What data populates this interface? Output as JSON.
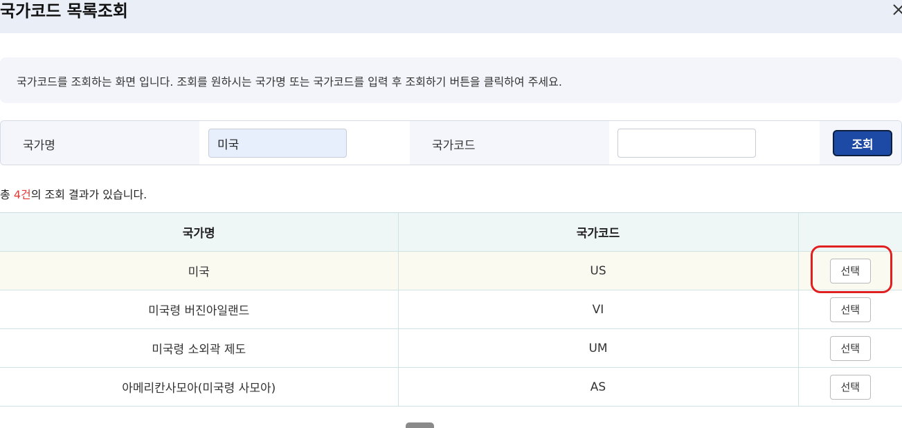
{
  "dialog": {
    "title": "국가코드 목록조회",
    "close_icon": "close-icon"
  },
  "notice": {
    "text": "국가코드를 조회하는 화면 입니다. 조회를 원하시는 국가명 또는 국가코드를 입력 후 조회하기 버튼을 클릭하여 주세요."
  },
  "search": {
    "name_label": "국가명",
    "name_value": "미국",
    "code_label": "국가코드",
    "code_value": "",
    "submit_label": "조회"
  },
  "result": {
    "prefix": "총 ",
    "count": "4건",
    "suffix": "의 조회 결과가 있습니다."
  },
  "table": {
    "headers": [
      "국가명",
      "국가코드",
      ""
    ],
    "rows": [
      {
        "name": "미국",
        "code": "US",
        "action": "선택"
      },
      {
        "name": "미국령 버진아일랜드",
        "code": "VI",
        "action": "선택"
      },
      {
        "name": "미국령 소외곽 제도",
        "code": "UM",
        "action": "선택"
      },
      {
        "name": "아메리칸사모아(미국령 사모아)",
        "code": "AS",
        "action": "선택"
      }
    ]
  },
  "colors": {
    "title_bar": "#e9eef7",
    "primary_button": "#1d4aa5",
    "count_highlight": "#e53935",
    "annotation": "#e0201f"
  }
}
